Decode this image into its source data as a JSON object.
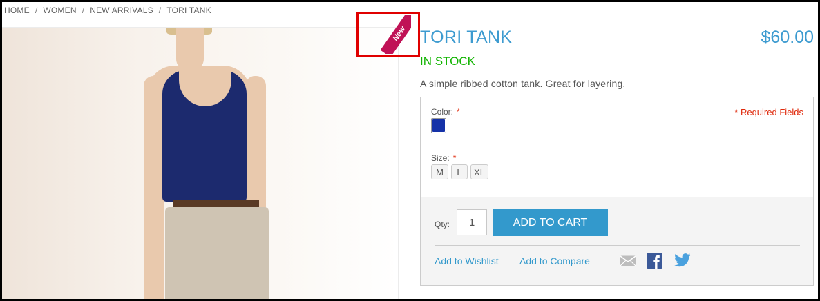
{
  "breadcrumb": [
    "HOME",
    "WOMEN",
    "NEW ARRIVALS",
    "TORI TANK"
  ],
  "breadcrumb_separator": "/",
  "badge": {
    "text": "New",
    "color": "#c01256"
  },
  "product": {
    "title": "TORI TANK",
    "price": "$60.00",
    "stock": "IN STOCK",
    "description": "A simple ribbed cotton tank. Great for layering."
  },
  "options": {
    "color_label": "Color:",
    "required_mark": "*",
    "required_fields": "* Required Fields",
    "swatch_color": "#1532a8",
    "size_label": "Size:",
    "sizes": [
      "M",
      "L",
      "XL"
    ]
  },
  "cart": {
    "qty_label": "Qty:",
    "qty_value": "1",
    "add_button": "ADD TO CART",
    "wishlist": "Add to Wishlist",
    "compare": "Add to Compare"
  },
  "icons": {
    "email": "email-icon",
    "facebook": "facebook-icon",
    "twitter": "twitter-icon"
  },
  "colors": {
    "accent": "#3399cc",
    "stock": "#11b400",
    "required": "#df280a"
  }
}
